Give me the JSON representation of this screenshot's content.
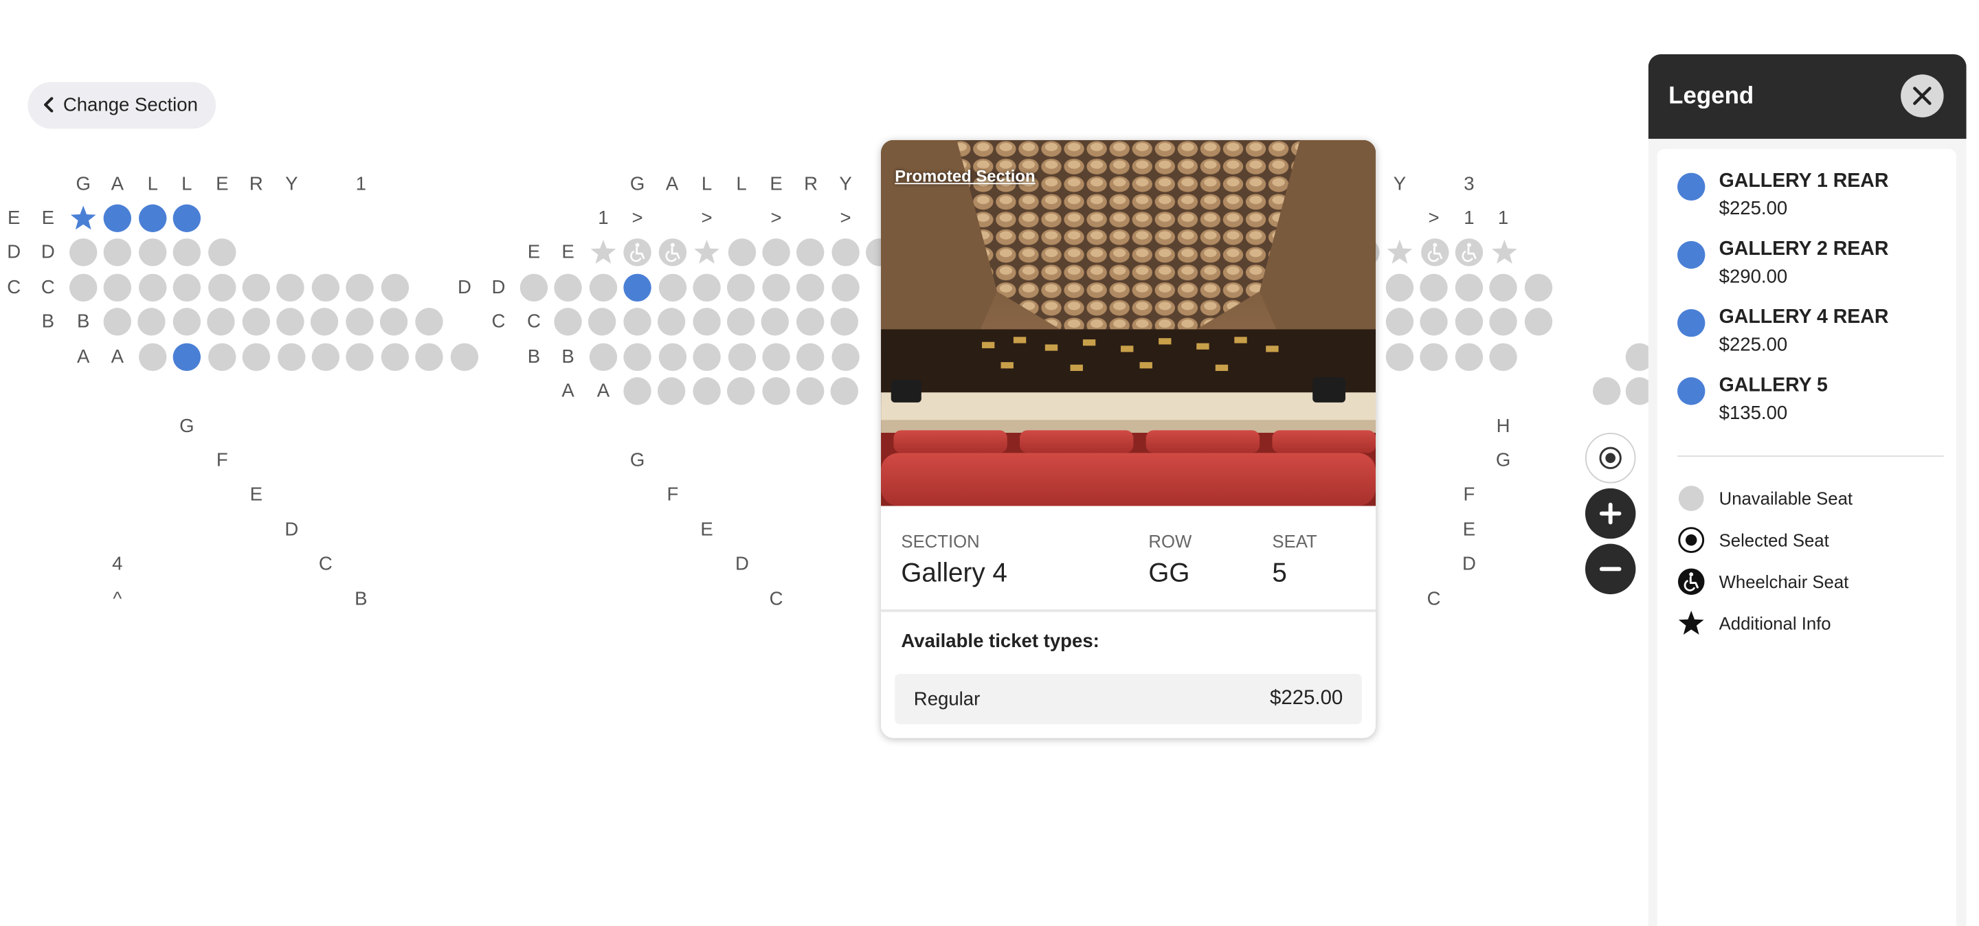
{
  "nav": {
    "back_label": "Change Section"
  },
  "map": {
    "section_titles": [
      "G A L L E R Y    1",
      "G A L L E R Y",
      "Y    3"
    ],
    "row_labels": [
      "E",
      "D",
      "C",
      "B",
      "A",
      "G",
      "F",
      "H",
      "4",
      "^",
      "1",
      ">"
    ]
  },
  "popup": {
    "promoted_label": "Promoted Section",
    "section_caption": "SECTION",
    "section_value": "Gallery 4",
    "row_caption": "ROW",
    "row_value": "GG",
    "seat_caption": "SEAT",
    "seat_value": "5",
    "types_title": "Available ticket types:",
    "tickets": [
      {
        "name": "Regular",
        "price": "$225.00"
      }
    ]
  },
  "legend": {
    "title": "Legend",
    "sections": [
      {
        "name": "GALLERY 1 REAR",
        "price": "$225.00",
        "color": "#4a7fd6"
      },
      {
        "name": "GALLERY 2 REAR",
        "price": "$290.00",
        "color": "#4a7fd6"
      },
      {
        "name": "GALLERY 4 REAR",
        "price": "$225.00",
        "color": "#4a7fd6"
      },
      {
        "name": "GALLERY 5",
        "price": "$135.00",
        "color": "#4a7fd6"
      }
    ],
    "keys": [
      {
        "label": "Unavailable Seat",
        "icon": "unavailable-seat-icon"
      },
      {
        "label": "Selected Seat",
        "icon": "selected-seat-icon"
      },
      {
        "label": "Wheelchair Seat",
        "icon": "wheelchair-icon"
      },
      {
        "label": "Additional Info",
        "icon": "star-icon"
      }
    ]
  },
  "colors": {
    "available": "#4a7fd6",
    "unavailable": "#d2d2d2",
    "dark": "#2b2b2b"
  }
}
